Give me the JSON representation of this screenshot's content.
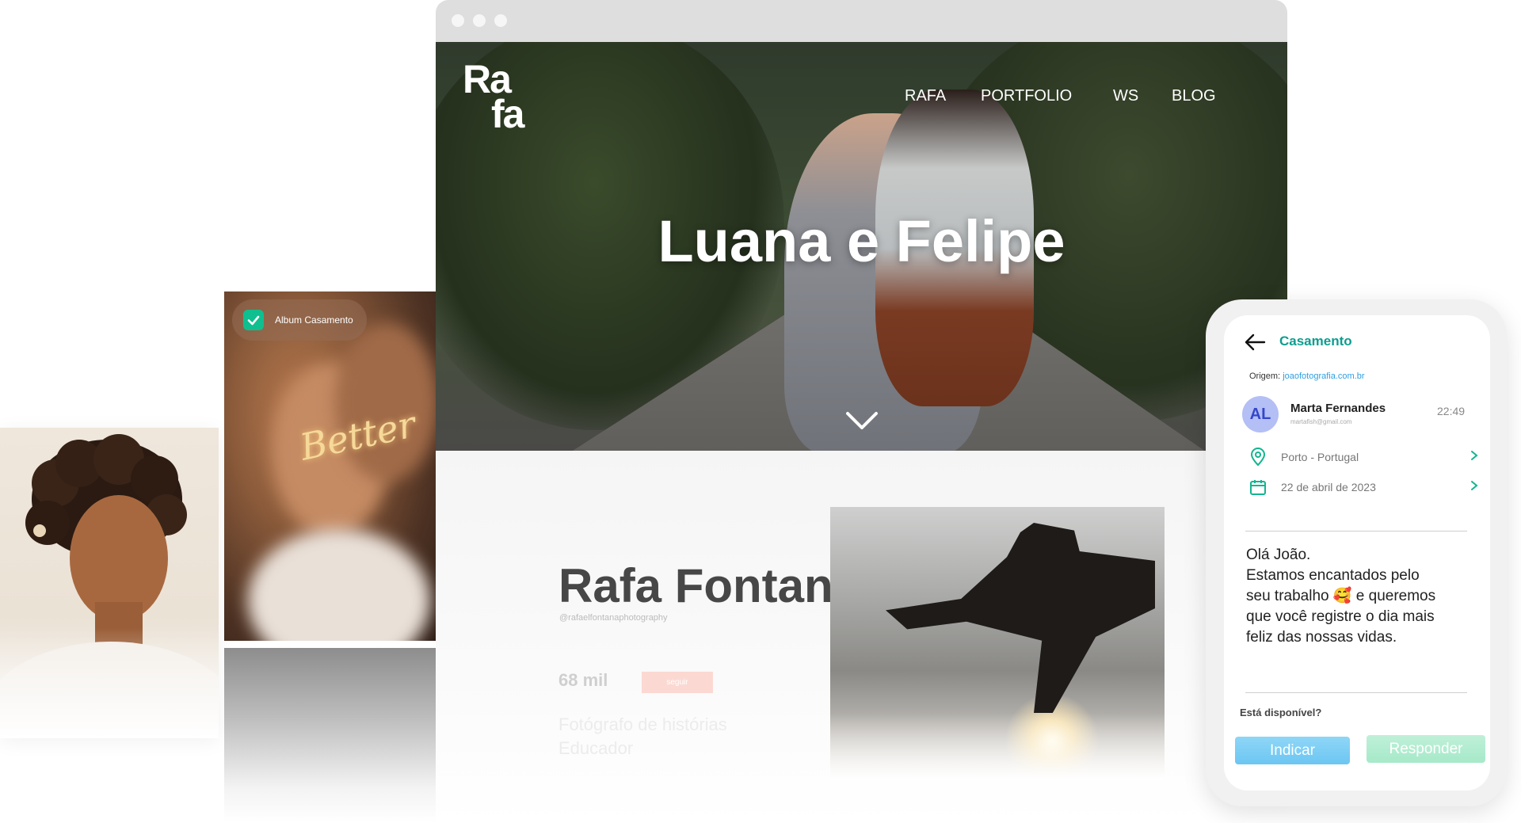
{
  "album_card": {
    "badge_label": "Album Casamento",
    "neon_text": "Better"
  },
  "browser": {
    "logo_line1": "Ra",
    "logo_line2": "fa",
    "nav": [
      "RAFA",
      "PORTFOLIO",
      "WS",
      "BLOG"
    ],
    "hero_title": "Luana e Felipe"
  },
  "profile": {
    "name": "Rafa Fontana",
    "handle": "@rafaelfontanaphotography",
    "followers": "68 mil",
    "follow_label": "seguir",
    "bio_line1": "Fotógrafo de histórias",
    "bio_line2": "Educador"
  },
  "phone": {
    "title": "Casamento",
    "origin_label": "Origem:",
    "origin_link": "joaofotografia.com.br",
    "avatar_initials": "AL",
    "contact_name": "Marta Fernandes",
    "contact_email": "martafish@gmail.com",
    "time": "22:49",
    "location": "Porto - Portugal",
    "date": "22 de abril de 2023",
    "message_lines": [
      "Olá João.",
      "Estamos encantados pelo",
      "seu trabalho 🥰  e queremos",
      "que você registre o dia mais",
      "feliz das nossas vidas."
    ],
    "question": "Está disponível?",
    "btn_indicar": "Indicar",
    "btn_responder": "Responder",
    "colors": {
      "accent": "#0d9d8f",
      "link": "#2e9fe0",
      "indicar": "#6cc6f2",
      "responder": "#a6e9c9"
    }
  }
}
